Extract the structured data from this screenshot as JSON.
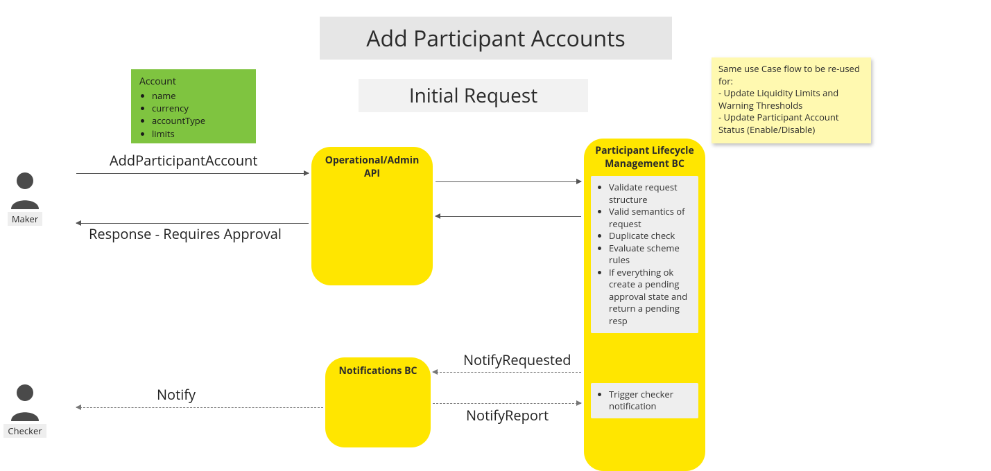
{
  "title": "Add Participant Accounts",
  "subtitle": "Initial Request",
  "account_box": {
    "heading": "Account",
    "fields": [
      "name",
      "currency",
      "accountType",
      "limits"
    ]
  },
  "sticky_note": {
    "lead": "Same use Case flow to be re-used for:",
    "item1": "- Update Liquidity Limits and Warning Thresholds",
    "item2": "- Update Participant Account Status (Enable/Disable)"
  },
  "actors": {
    "maker": "Maker",
    "checker": "Checker"
  },
  "components": {
    "api": "Operational/Admin API",
    "notifications": "Notifications BC",
    "plm": "Participant Lifecycle Management BC"
  },
  "plm_steps": [
    "Validate request structure",
    "Valid semantics of request",
    "Duplicate check",
    "Evaluate scheme rules",
    "If everything ok create a pending approval state and return a pending resp"
  ],
  "plm_trigger": [
    "Trigger checker notification"
  ],
  "arrows": {
    "add_participant": "AddParticipantAccount",
    "response": "Response - Requires Approval",
    "notify_requested": "NotifyRequested",
    "notify_report": "NotifyReport",
    "notify": "Notify"
  }
}
